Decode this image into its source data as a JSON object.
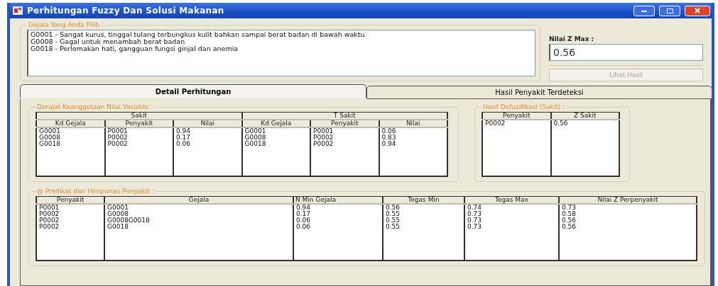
{
  "window": {
    "title": "Perhitungan Fuzzy Dan Solusi Makanan"
  },
  "selected_symptoms": {
    "label": "Gejala Yang Anda Pilih :",
    "lines": [
      "G0001 - Sangat kurus, tinggal tulang terbungkus kulit bahkan sampai berat badan di bawah waktu",
      "G0008 - Gagal untuk menambah berat badan",
      "G0018 - Perlemakan hati, gangguan fungsi ginjal dan anemia"
    ]
  },
  "z_max": {
    "label": "Nilai Z Max :",
    "value": "0.56"
  },
  "result_button": {
    "label": "Lihat Hasil",
    "disabled": true
  },
  "tabs": [
    {
      "label": "Detail Perhitungan",
      "selected": true
    },
    {
      "label": "Hasil Penyakit Terdeteksi",
      "selected": false
    }
  ],
  "membership": {
    "label": "Derajat Keanggotaan Nilai Variable :",
    "groups": [
      {
        "title": "Sakit",
        "columns": [
          "Kd Gejala",
          "Penyakit",
          "Nilai"
        ]
      },
      {
        "title": "T Sakit",
        "columns": [
          "Kd Gejala",
          "Penyakit",
          "Nilai"
        ]
      }
    ],
    "rows": [
      [
        "G0001",
        "P0001",
        "0.94",
        "G0001",
        "P0001",
        "0.06"
      ],
      [
        "G0008",
        "P0002",
        "0.17",
        "G0008",
        "P0002",
        "0.83"
      ],
      [
        "G0018",
        "P0002",
        "0.06",
        "G0018",
        "P0002",
        "0.94"
      ]
    ]
  },
  "defuzzification": {
    "label": "Hasil Defuzifikasi (Sakit) :",
    "columns": [
      "Penyakit",
      "Z Sakit"
    ],
    "rows": [
      [
        "P0002",
        "0.56"
      ]
    ]
  },
  "predicates": {
    "label": "@ Predikat dan Himpunan Penyakit :",
    "columns": [
      "Penyakit",
      "Gejala",
      "N Min Gejala",
      "Tegas Min",
      "Tegas Max",
      "Nilai Z Perpenyakit"
    ],
    "rows": [
      [
        "P0001",
        "G0001",
        "0.94",
        "0.56",
        "0.74",
        "0.73"
      ],
      [
        "P0002",
        "G0008",
        "0.17",
        "0.55",
        "0.73",
        "0.58"
      ],
      [
        "P0002",
        "G0008G0018",
        "0.06",
        "0.55",
        "0.73",
        "0.56"
      ],
      [
        "P0002",
        "G0018",
        "0.06",
        "0.55",
        "0.73",
        "0.56"
      ]
    ]
  }
}
